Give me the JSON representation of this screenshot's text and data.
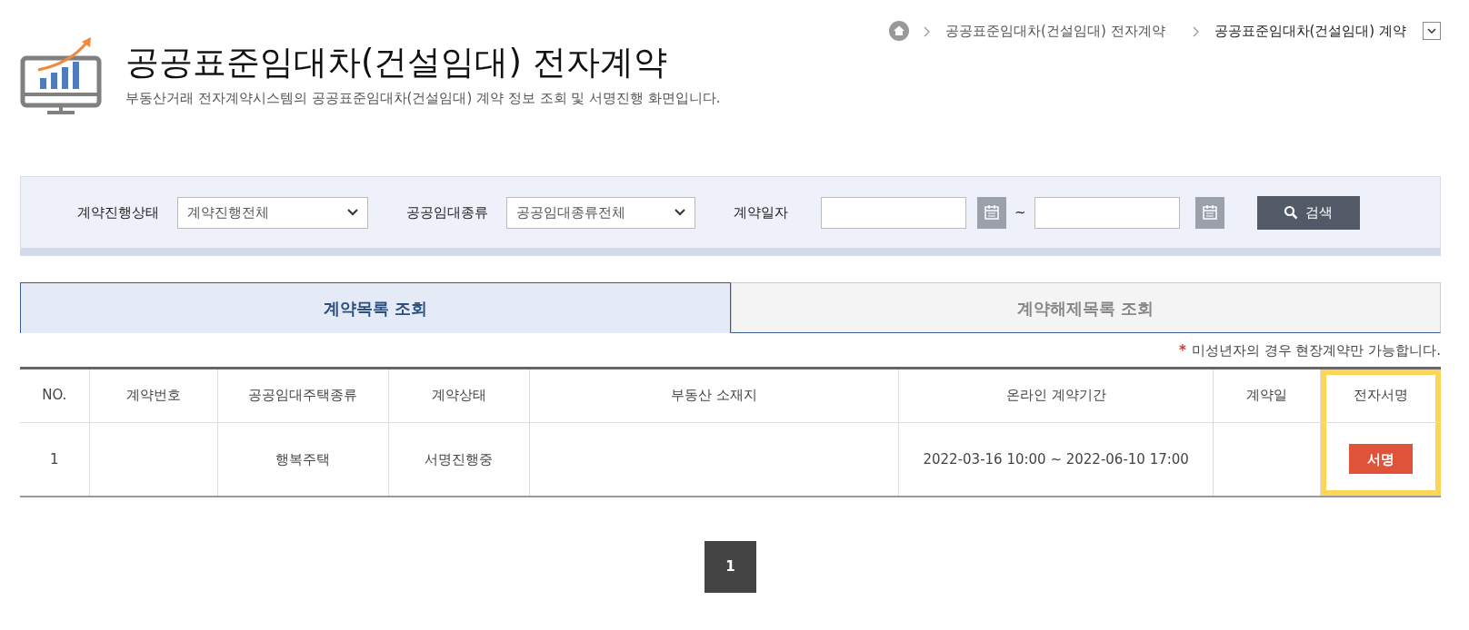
{
  "breadcrumb": {
    "items": [
      "공공표준임대차(건설임대) 전자계약",
      "공공표준임대차(건설임대) 계약"
    ]
  },
  "header": {
    "title": "공공표준임대차(건설임대) 전자계약",
    "description": "부동산거래 전자계약시스템의 공공표준임대차(건설임대) 계약 정보 조회 및 서명진행 화면입니다."
  },
  "search": {
    "status_label": "계약진행상태",
    "status_value": "계약진행전체",
    "type_label": "공공임대종류",
    "type_value": "공공임대종류전체",
    "date_label": "계약일자",
    "date_separator": "~",
    "button": "검색"
  },
  "tabs": [
    {
      "label": "계약목록 조회",
      "selected": true
    },
    {
      "label": "계약해제목록 조회",
      "selected": false
    }
  ],
  "note": {
    "mark": "*",
    "text": "미성년자의 경우 현장계약만 가능합니다."
  },
  "table": {
    "columns": [
      {
        "label": "NO.",
        "highlighted": false
      },
      {
        "label": "계약번호",
        "highlighted": false
      },
      {
        "label": "공공임대주택종류",
        "highlighted": false
      },
      {
        "label": "계약상태",
        "highlighted": false
      },
      {
        "label": "부동산 소재지",
        "highlighted": false
      },
      {
        "label": "온라인 계약기간",
        "highlighted": false
      },
      {
        "label": "계약일",
        "highlighted": false
      },
      {
        "label": "전자서명",
        "highlighted": true
      }
    ],
    "rows": [
      {
        "no": "1",
        "type": "행복주택",
        "status": "서명진행중",
        "period": "2022-03-16 10:00 ~ 2022-06-10 17:00",
        "sign_button": "서명"
      }
    ]
  },
  "pagination": [
    {
      "label": "1",
      "selected": true
    }
  ]
}
